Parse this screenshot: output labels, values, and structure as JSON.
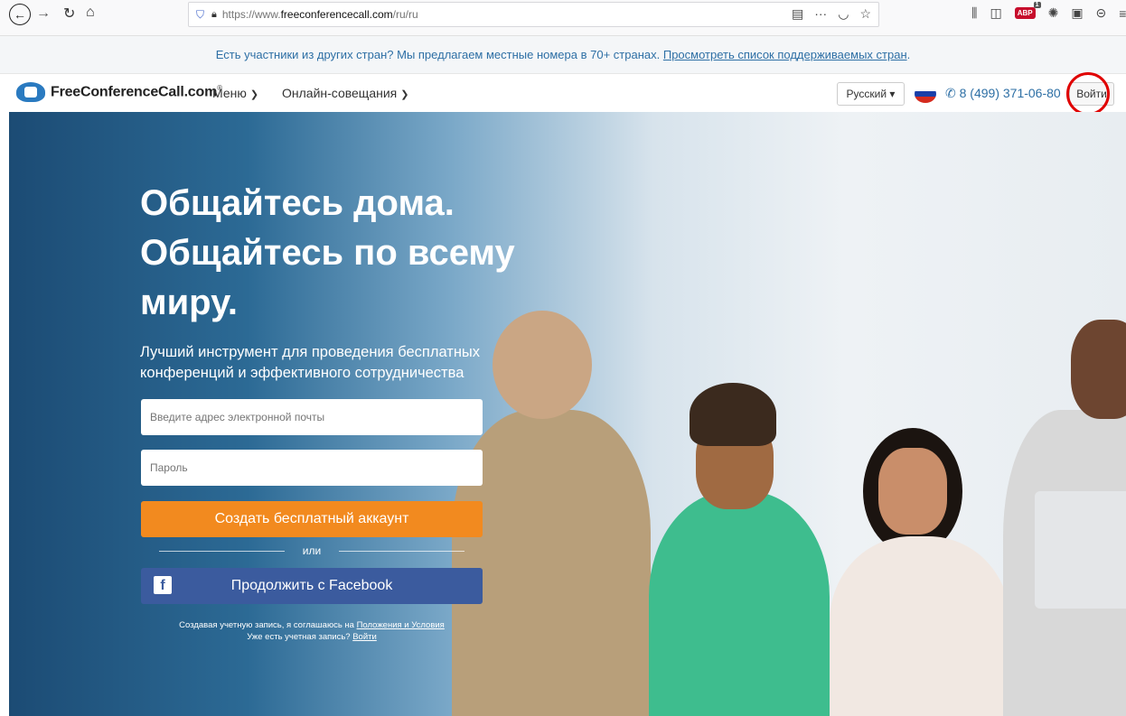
{
  "browser": {
    "url_prefix": "https://www.",
    "url_domain": "freeconferencecall.com",
    "url_path": "/ru/ru",
    "more_glyph": "···"
  },
  "notice": {
    "text": "Есть участники из других стран? Мы предлагаем местные номера в 70+ странах.",
    "link": "Просмотреть список поддерживаемых стран"
  },
  "nav": {
    "logo_text": "FreeConferenceCall.com",
    "menu": "Меню",
    "meetings": "Онлайн-совещания",
    "language": "Русский",
    "phone": "8 (499) 371-06-80",
    "login": "Войти"
  },
  "hero": {
    "title": "Общайтесь дома. Общайтесь по всему миру.",
    "subtitle": "Лучший инструмент для проведения бесплатных конференций и эффективного сотрудничества",
    "email_placeholder": "Введите адрес электронной почты",
    "password_placeholder": "Пароль",
    "create_button": "Создать бесплатный аккаунт",
    "or": "или",
    "facebook_button": "Продолжить с Facebook",
    "terms_prefix": "Создавая учетную запись, я соглашаюсь на",
    "terms_link": "Положения и Условия",
    "have_account": "Уже есть учетная запись?",
    "login_link": "Войти"
  },
  "colors": {
    "accent_orange": "#f28a1f",
    "facebook_blue": "#3b5b9e",
    "link_blue": "#2d6fa5",
    "highlight_red": "#e00000"
  }
}
